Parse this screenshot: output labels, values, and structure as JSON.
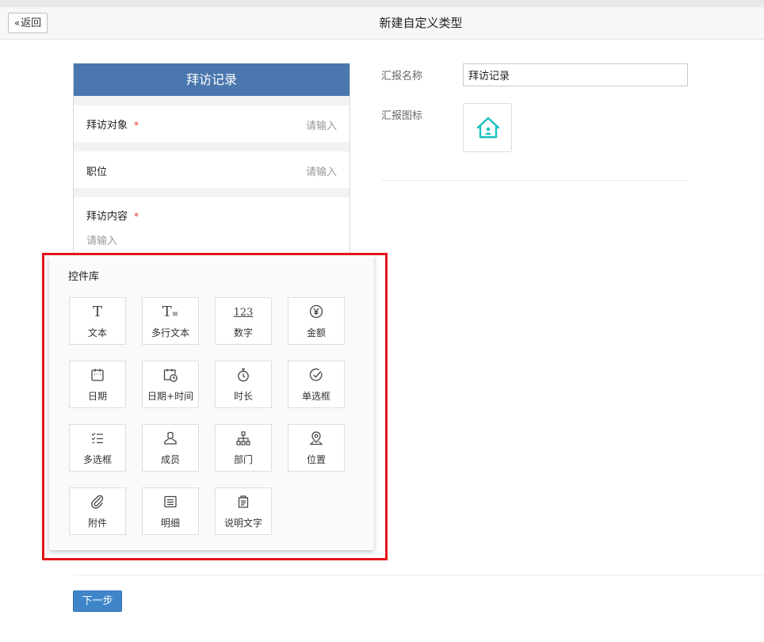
{
  "header": {
    "back_label": "返回",
    "title": "新建自定义类型"
  },
  "preview": {
    "title": "拜访记录",
    "rows": [
      {
        "label": "拜访对象",
        "required": "*",
        "placeholder": "请输入"
      },
      {
        "label": "职位",
        "placeholder": "请输入"
      },
      {
        "label": "拜访内容",
        "required": "*",
        "placeholder": "请输入"
      }
    ]
  },
  "form": {
    "name_label": "汇报名称",
    "name_value": "拜访记录",
    "icon_label": "汇报图标",
    "icon": "house-user-icon",
    "icon_color": "#1bbfbf"
  },
  "library": {
    "title": "控件库",
    "items": [
      {
        "label": "文本",
        "icon": "text-icon"
      },
      {
        "label": "多行文本",
        "icon": "multiline-text-icon"
      },
      {
        "label": "数字",
        "icon": "number-icon"
      },
      {
        "label": "金额",
        "icon": "yen-icon"
      },
      {
        "label": "日期",
        "icon": "calendar-icon"
      },
      {
        "label": "日期+时间",
        "icon": "calendar-clock-icon"
      },
      {
        "label": "时长",
        "icon": "stopwatch-icon"
      },
      {
        "label": "单选框",
        "icon": "check-circle-icon"
      },
      {
        "label": "多选框",
        "icon": "checklist-icon"
      },
      {
        "label": "成员",
        "icon": "user-icon"
      },
      {
        "label": "部门",
        "icon": "org-chart-icon"
      },
      {
        "label": "位置",
        "icon": "location-pin-icon"
      },
      {
        "label": "附件",
        "icon": "paperclip-icon"
      },
      {
        "label": "明细",
        "icon": "detail-list-icon"
      },
      {
        "label": "说明文字",
        "icon": "document-icon"
      }
    ],
    "glyphs": {
      "text": "T",
      "multiline": "T",
      "number": "123"
    }
  },
  "footer": {
    "next_label": "下一步"
  },
  "colors": {
    "preview_header": "#4a77ae",
    "primary_button": "#3e86c9",
    "required": "#e33333",
    "highlight": "#e5141b"
  }
}
